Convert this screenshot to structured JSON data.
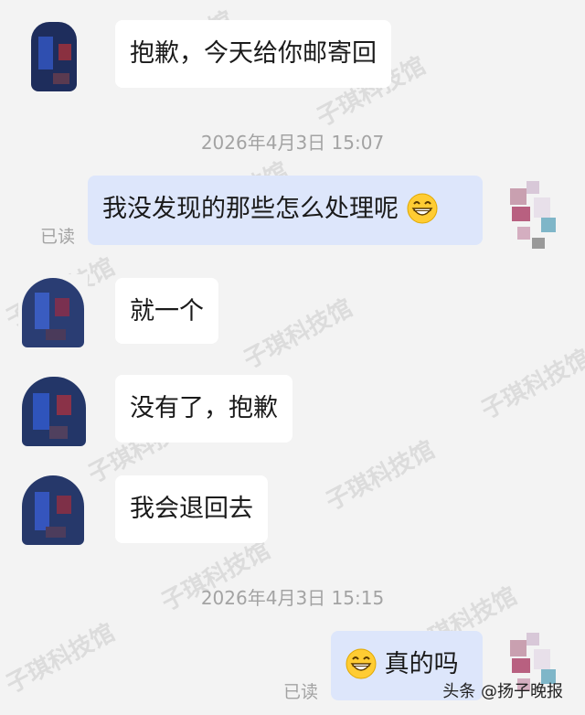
{
  "messages": [
    {
      "text": "抱歉，今天给你邮寄回"
    },
    {
      "timestamp": "2026年4月3日 15:07"
    },
    {
      "text": "我没发现的那些怎么处理呢",
      "read": "已读"
    },
    {
      "text": "就一个"
    },
    {
      "text": "没有了，抱歉"
    },
    {
      "text": "我会退回去"
    },
    {
      "timestamp": "2026年4月3日 15:15"
    },
    {
      "text": "真的吗",
      "read": "已读"
    }
  ],
  "emoji_icon": "grinning-face-emoji",
  "watermark": "子琪科技馆",
  "footer": "头条 @扬子晚报",
  "colors": {
    "background": "#f3f3f3",
    "bubble_other": "#ffffff",
    "bubble_mine": "#dde6fb",
    "meta_text": "#a3a3a3"
  }
}
